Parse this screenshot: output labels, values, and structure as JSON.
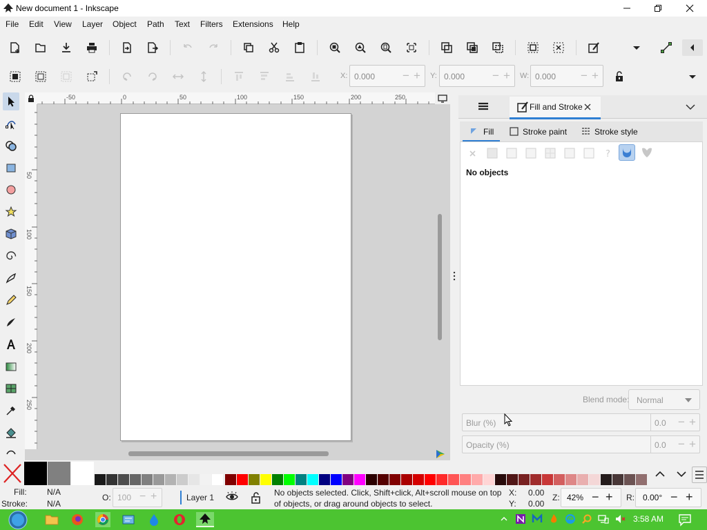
{
  "window": {
    "title": "New document 1 - Inkscape"
  },
  "menu": [
    "File",
    "Edit",
    "View",
    "Layer",
    "Object",
    "Path",
    "Text",
    "Filters",
    "Extensions",
    "Help"
  ],
  "controls": {
    "x_label": "X:",
    "x_value": "0.000",
    "y_label": "Y:",
    "y_value": "0.000",
    "w_label": "W:",
    "w_value": "0.000"
  },
  "ruler": {
    "top": [
      "-50",
      "0",
      "50",
      "100",
      "150",
      "200",
      "250"
    ],
    "left": [
      "50",
      "100",
      "150",
      "200",
      "250"
    ]
  },
  "dock": {
    "tab_label": "Fill and Stroke",
    "subtabs": {
      "fill": "Fill",
      "stroke_paint": "Stroke paint",
      "stroke_style": "Stroke style"
    },
    "no_objects": "No objects",
    "blend_label": "Blend mode:",
    "blend_value": "Normal",
    "blur_label": "Blur (%)",
    "blur_value": "0.0",
    "opacity_label": "Opacity (%)",
    "opacity_value": "0.0"
  },
  "status": {
    "fill_label": "Fill:",
    "fill_value": "N/A",
    "stroke_label": "Stroke:",
    "stroke_value": "N/A",
    "opacity_label": "O:",
    "opacity_value": "100",
    "layer": "Layer 1",
    "message_line1": "No objects selected. Click, Shift+click, Alt+scroll mouse on top",
    "message_line2": "of objects, or drag around objects to select.",
    "x_label": "X:",
    "x_value": "0.00",
    "y_label": "Y:",
    "y_value": "0.00",
    "zoom_label": "Z:",
    "zoom_value": "42%",
    "rotate_label": "R:",
    "rotate_value": "0.00°"
  },
  "taskbar": {
    "time": "3:58 AM"
  },
  "colors": {
    "accent": "#2f7fd3",
    "taskbar": "#4cc431",
    "palette": [
      "#000000",
      "#808080",
      "#ffffff",
      "#1a1a1a",
      "#333333",
      "#4d4d4d",
      "#666666",
      "#808080",
      "#999999",
      "#b3b3b3",
      "#cccccc",
      "#e6e6e6",
      "#f2f2f2",
      "#ffffff",
      "#800000",
      "#ff0000",
      "#808000",
      "#ffff00",
      "#008000",
      "#00ff00",
      "#008080",
      "#00ffff",
      "#000080",
      "#0000ff",
      "#800080",
      "#ff00ff",
      "#2b0000",
      "#550000",
      "#800000",
      "#aa0000",
      "#d40000",
      "#ff0000",
      "#ff2a2a",
      "#ff5555",
      "#ff8080",
      "#ffaaaa",
      "#ffd5d5",
      "#280b0b",
      "#501616",
      "#782121",
      "#a02c2c",
      "#c83737",
      "#d35f5f",
      "#de8787",
      "#e9afaf",
      "#f4d7d7",
      "#241c1c",
      "#483737",
      "#6c5353",
      "#916f6f"
    ]
  }
}
